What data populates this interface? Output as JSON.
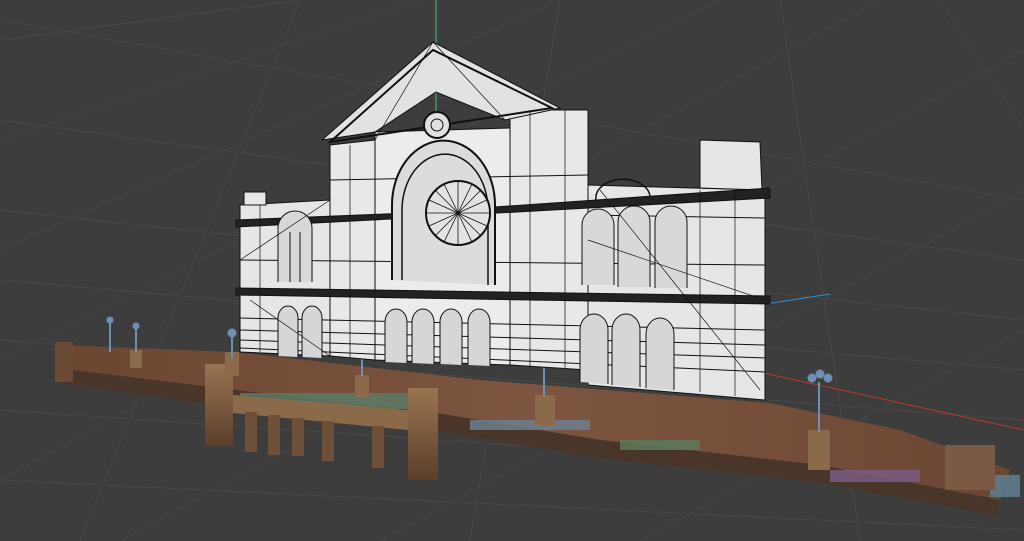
{
  "viewport": {
    "mode": "wireframe-overlay",
    "background": "#3d3d3d",
    "grid_color": "#4a4a4a",
    "axis_x_color": "#c0392b",
    "axis_y_color": "#2ecc71",
    "axis_z_color": "#2f8fd8"
  },
  "scene": {
    "model": {
      "wireframe_color": "#0f0f0f",
      "surface_color": "#e8e8e8",
      "textured_ground_color": "#7a5238"
    },
    "lamps": {
      "color": "#6e8fb8"
    }
  }
}
